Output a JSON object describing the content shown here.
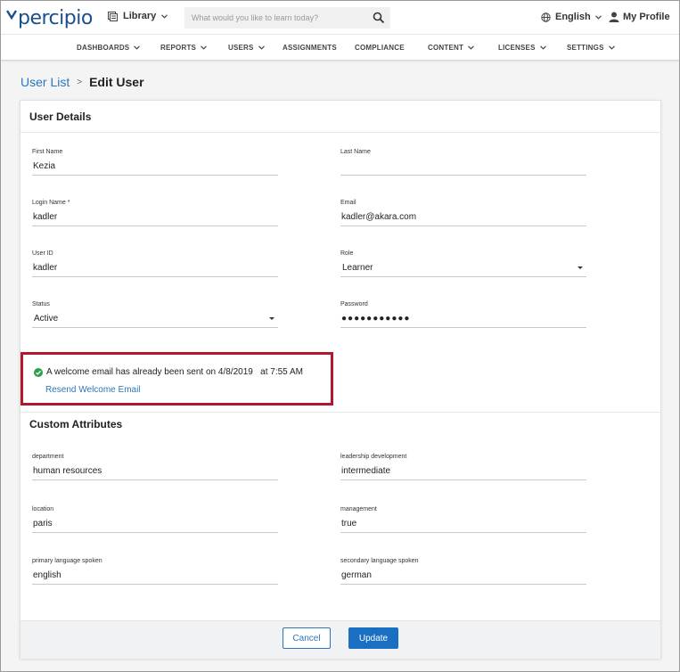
{
  "header": {
    "logo_text": "percipio",
    "library_label": "Library",
    "search": {
      "placeholder": "What would you like to learn today?",
      "value": ""
    },
    "language_label": "English",
    "profile_label": "My Profile"
  },
  "nav": {
    "items": [
      {
        "label": "DASHBOARDS",
        "has_menu": true
      },
      {
        "label": "REPORTS",
        "has_menu": true
      },
      {
        "label": "USERS",
        "has_menu": true
      },
      {
        "label": "ASSIGNMENTS",
        "has_menu": false
      },
      {
        "label": "COMPLIANCE",
        "has_menu": false
      },
      {
        "label": "CONTENT",
        "has_menu": true
      },
      {
        "label": "LICENSES",
        "has_menu": true
      },
      {
        "label": "SETTINGS",
        "has_menu": true
      }
    ]
  },
  "breadcrumb": {
    "parent": "User List",
    "separator": ">",
    "current": "Edit User"
  },
  "user_details": {
    "title": "User Details",
    "first_name": {
      "label": "First Name",
      "value": "Kezia"
    },
    "last_name": {
      "label": "Last Name",
      "value": ""
    },
    "login_name": {
      "label": "Login Name *",
      "value": "kadler"
    },
    "email": {
      "label": "Email",
      "value": "kadler@akara.com"
    },
    "user_id": {
      "label": "User ID",
      "value": "kadler"
    },
    "role": {
      "label": "Role",
      "value": "Learner"
    },
    "status": {
      "label": "Status",
      "value": "Active"
    },
    "password": {
      "label": "Password",
      "value": "●●●●●●●●●●●"
    }
  },
  "welcome": {
    "message": "A welcome email has already been sent on 4/8/2019   at 7:55 AM",
    "resend_label": "Resend Welcome Email"
  },
  "custom_attributes": {
    "title": "Custom Attributes",
    "department": {
      "label": "department",
      "value": "human resources"
    },
    "leadership": {
      "label": "leadership development",
      "value": "intermediate"
    },
    "location": {
      "label": "location",
      "value": "paris"
    },
    "management": {
      "label": "management",
      "value": "true"
    },
    "primary_lang": {
      "label": "primary language spoken",
      "value": "english"
    },
    "secondary_lang": {
      "label": "secondary language spoken",
      "value": "german"
    }
  },
  "actions": {
    "cancel_label": "Cancel",
    "update_label": "Update"
  },
  "colors": {
    "brand": "#1a4f8c",
    "link": "#2a77bd",
    "primary_button": "#1a6fc2",
    "highlight_border": "#b0192d",
    "success": "#2e9e4f"
  }
}
